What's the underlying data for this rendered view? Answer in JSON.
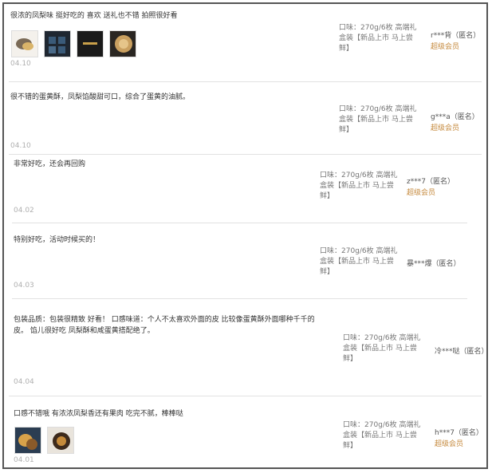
{
  "reviews": [
    {
      "content": "很浓的凤梨味 挺好吃的 喜欢 送礼也不错 拍照很好看",
      "date": "04.10",
      "spec": "口味：270g/6枚 高端礼盒装【新品上市 马上尝鲜】",
      "user": "r***背（匿名）",
      "level": "超级会员",
      "photos": [
        "photo-icon",
        "photo-icon",
        "photo-icon",
        "photo-icon"
      ]
    },
    {
      "content": "很不错的蛋黄酥，凤梨馅酸甜可口，综合了蛋黄的油腻。",
      "date": "04.10",
      "spec": "口味：270g/6枚 高端礼盒装【新品上市 马上尝鲜】",
      "user": "g***a（匿名）",
      "level": "超级会员"
    },
    {
      "content": "非常好吃，还会再回购",
      "date": "04.02",
      "spec": "口味：270g/6枚 高端礼盒装【新品上市 马上尝鲜】",
      "user": "z***7（匿名）",
      "level": "超级会员"
    },
    {
      "content": "特别好吃，活动时候买的！",
      "date": "04.03",
      "spec": "口味：270g/6枚 高端礼盒装【新品上市 马上尝鲜】",
      "user": "暴***爆（匿名）",
      "level": ""
    },
    {
      "content": "包装品质：包装很精致 好看！ 口感味道：个人不太喜欢外面的皮 比较像蛋黄酥外面哪种千千的皮。 馅儿很好吃 凤梨酥和咸蛋黄搭配绝了。",
      "date": "04.04",
      "spec": "口味：270g/6枚 高端礼盒装【新品上市 马上尝鲜】",
      "user": "冷***哒（匿名）",
      "level": ""
    },
    {
      "content": "口感不错哦 有浓浓凤梨香还有果肉 吃完不腻，棒棒哒",
      "date": "04.01",
      "spec": "口味：270g/6枚 高端礼盒装【新品上市 马上尝鲜】",
      "user": "h***7（匿名）",
      "level": "超级会员",
      "photos": [
        "photo-icon",
        "photo-icon"
      ]
    }
  ]
}
